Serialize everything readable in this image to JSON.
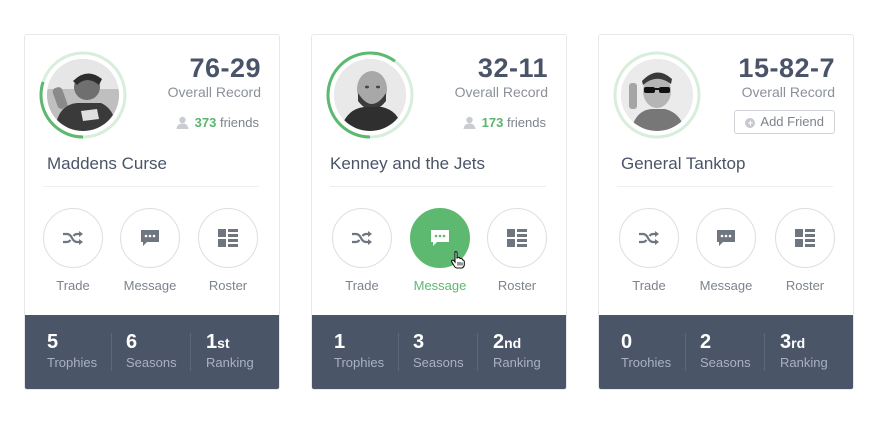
{
  "colors": {
    "accent": "#5cb96f",
    "stats_bg": "#4b5568",
    "text": "#4a5468"
  },
  "cards": [
    {
      "record": "76-29",
      "record_label": "Overall Record",
      "friends_count": "373",
      "friends_label": "friends",
      "team_name": "Maddens Curse",
      "ring_progress": 0.3,
      "actions": [
        {
          "label": "Trade",
          "icon": "shuffle-icon"
        },
        {
          "label": "Message",
          "icon": "chat-icon"
        },
        {
          "label": "Roster",
          "icon": "list-icon"
        }
      ],
      "stats": [
        {
          "num": "5",
          "suffix": "",
          "label": "Trophies"
        },
        {
          "num": "6",
          "suffix": "",
          "label": "Seasons"
        },
        {
          "num": "1",
          "suffix": "st",
          "label": "Ranking"
        }
      ]
    },
    {
      "record": "32-11",
      "record_label": "Overall Record",
      "friends_count": "173",
      "friends_label": "friends",
      "team_name": "Kenney and the Jets",
      "ring_progress": 0.6,
      "actions": [
        {
          "label": "Trade",
          "icon": "shuffle-icon"
        },
        {
          "label": "Message",
          "icon": "chat-icon",
          "active": true
        },
        {
          "label": "Roster",
          "icon": "list-icon"
        }
      ],
      "stats": [
        {
          "num": "1",
          "suffix": "",
          "label": "Trophies"
        },
        {
          "num": "3",
          "suffix": "",
          "label": "Seasons"
        },
        {
          "num": "2",
          "suffix": "nd",
          "label": "Ranking"
        }
      ]
    },
    {
      "record": "15-82-7",
      "record_label": "Overall Record",
      "add_friend_label": "Add Friend",
      "team_name": "General Tanktop",
      "ring_progress": 0.0,
      "actions": [
        {
          "label": "Trade",
          "icon": "shuffle-icon"
        },
        {
          "label": "Message",
          "icon": "chat-icon"
        },
        {
          "label": "Roster",
          "icon": "list-icon"
        }
      ],
      "stats": [
        {
          "num": "0",
          "suffix": "",
          "label": "Troohies"
        },
        {
          "num": "2",
          "suffix": "",
          "label": "Seasons"
        },
        {
          "num": "3",
          "suffix": "rd",
          "label": "Ranking"
        }
      ]
    }
  ]
}
